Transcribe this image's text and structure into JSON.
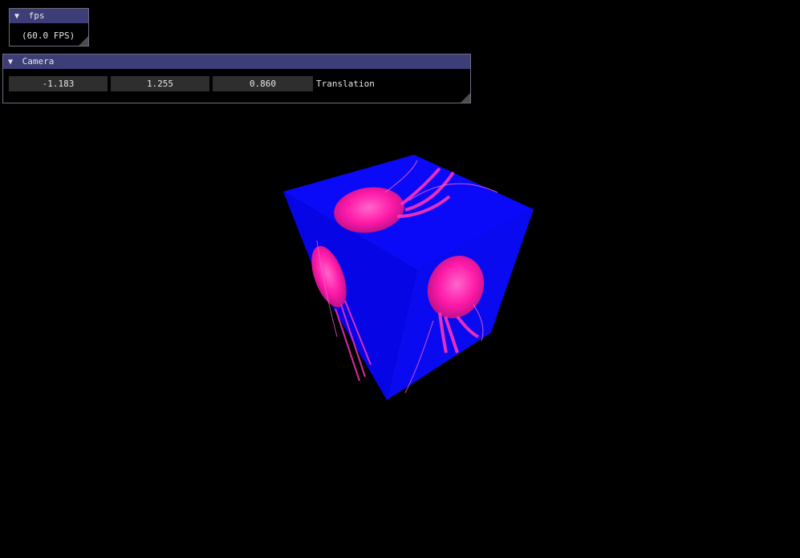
{
  "fps_window": {
    "title": "fps",
    "collapse_icon": "triangle-down",
    "fps_text": "(60.0 FPS)"
  },
  "camera_window": {
    "title": "Camera",
    "collapse_icon": "triangle-down",
    "translation": {
      "x": "-1.183",
      "y": "1.255",
      "z": "0.860",
      "label": "Translation"
    }
  },
  "scene": {
    "background": "#000000",
    "cube_face_color": "#0a0af8",
    "texture_accent": "#ff1aa8"
  },
  "theme": {
    "title_bar": "#3d3d78",
    "field_bg": "#2e2e2e"
  }
}
